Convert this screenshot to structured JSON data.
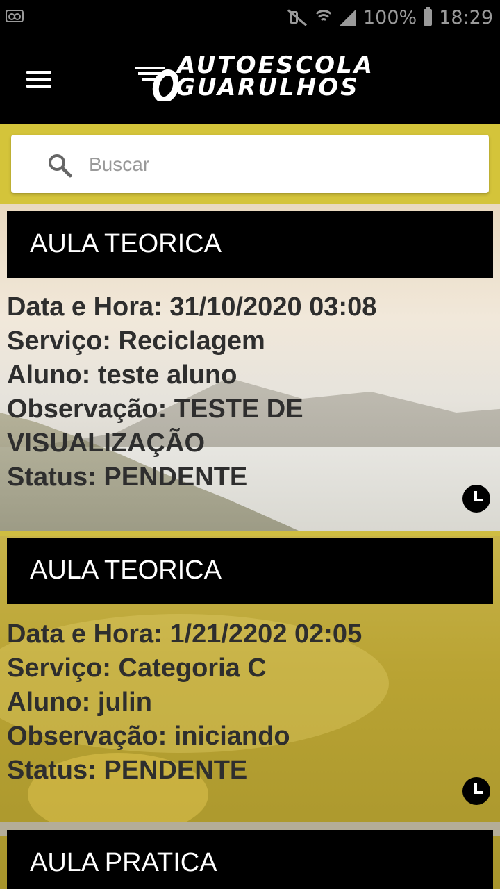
{
  "status_bar": {
    "battery_percent": "100%",
    "time": "18:29",
    "icons": [
      "voicemail-icon",
      "mute-icon",
      "wifi-icon",
      "signal-icon",
      "battery-icon"
    ]
  },
  "app_bar": {
    "logo_line1": "AUTOESCOLA",
    "logo_line2": "GUARULHOS"
  },
  "search": {
    "placeholder": "Buscar",
    "value": ""
  },
  "cards": [
    {
      "title": "AULA TEORICA",
      "date": "Data e Hora: 31/10/2020 03:08",
      "service": "Serviço: Reciclagem",
      "student": "Aluno: teste aluno",
      "observation_line1": "Observação: TESTE DE",
      "observation_line2": "VISUALIZAÇÃO",
      "status": "Status: PENDENTE"
    },
    {
      "title": "AULA TEORICA",
      "date": "Data e Hora: 1/21/2202 02:05",
      "service": "Serviço: Categoria C",
      "student": "Aluno: julin",
      "observation_line1": "Observação: iniciando",
      "status": "Status: PENDENTE"
    },
    {
      "title": "AULA PRATICA"
    }
  ],
  "colors": {
    "accent_yellow": "#d4c43a",
    "header_black": "#000000",
    "text_dark": "#2e2e2e"
  }
}
